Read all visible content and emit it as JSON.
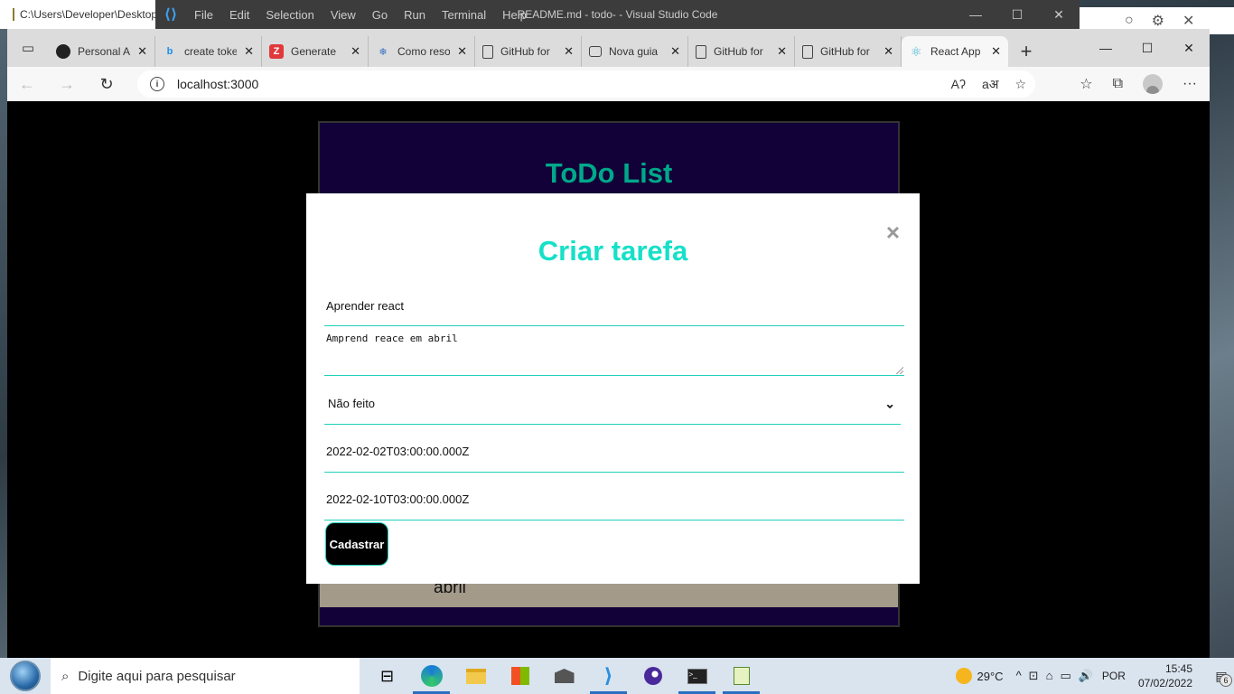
{
  "notepad": {
    "title": "C:\\Users\\Developer\\Desktop"
  },
  "vscode": {
    "logo": "⟨⟩",
    "menu": [
      "File",
      "Edit",
      "Selection",
      "View",
      "Go",
      "Run",
      "Terminal",
      "Help"
    ],
    "title": "README.md - todo- - Visual Studio Code",
    "controls": {
      "minimize": "—",
      "maximize": "☐",
      "close": "✕"
    }
  },
  "browser": {
    "tabs": [
      {
        "label": "Personal Access Tokens",
        "icon": "github-icon",
        "glyph": "●"
      },
      {
        "label": "create token",
        "icon": "bing-icon",
        "glyph": "b"
      },
      {
        "label": "Generate",
        "icon": "z-icon",
        "glyph": "Z"
      },
      {
        "label": "Como resolver",
        "icon": "snowflake-icon",
        "glyph": "❄"
      },
      {
        "label": "GitHub for",
        "icon": "page-icon",
        "glyph": ""
      },
      {
        "label": "Nova guia",
        "icon": "window-icon",
        "glyph": ""
      },
      {
        "label": "GitHub for",
        "icon": "page-icon",
        "glyph": ""
      },
      {
        "label": "GitHub for",
        "icon": "page-icon",
        "glyph": ""
      },
      {
        "label": "React App",
        "icon": "react-icon",
        "glyph": "⚛",
        "active": true
      }
    ],
    "close_glyph": "✕",
    "new_tab": "+",
    "controls": {
      "minimize": "—",
      "maximize": "☐",
      "close": "✕"
    },
    "nav": {
      "back": "←",
      "forward": "→",
      "reload": "↻"
    },
    "address": "localhost:3000",
    "address_icons": [
      "Aʔ",
      "aअ",
      "☆"
    ],
    "tool_icons": [
      "☆",
      "⧉"
    ],
    "menu_glyph": "···"
  },
  "app": {
    "title": "ToDo List",
    "task_card_text": "abril"
  },
  "modal": {
    "close": "×",
    "title": "Criar tarefa",
    "task_name": "Aprender react",
    "description": "Amprend reace em abril",
    "status": "Não feito",
    "start_date": "2022-02-02T03:00:00.000Z",
    "end_date": "2022-02-10T03:00:00.000Z",
    "submit": "Cadastrar"
  },
  "taskbar": {
    "search_placeholder": "Digite aqui para pesquisar",
    "temperature": "29°C",
    "tray_icons": [
      "^",
      "⊡",
      "⌂",
      "▭",
      "🔊"
    ],
    "language": "POR",
    "time": "15:45",
    "date": "07/02/2022",
    "notifications": "6"
  }
}
